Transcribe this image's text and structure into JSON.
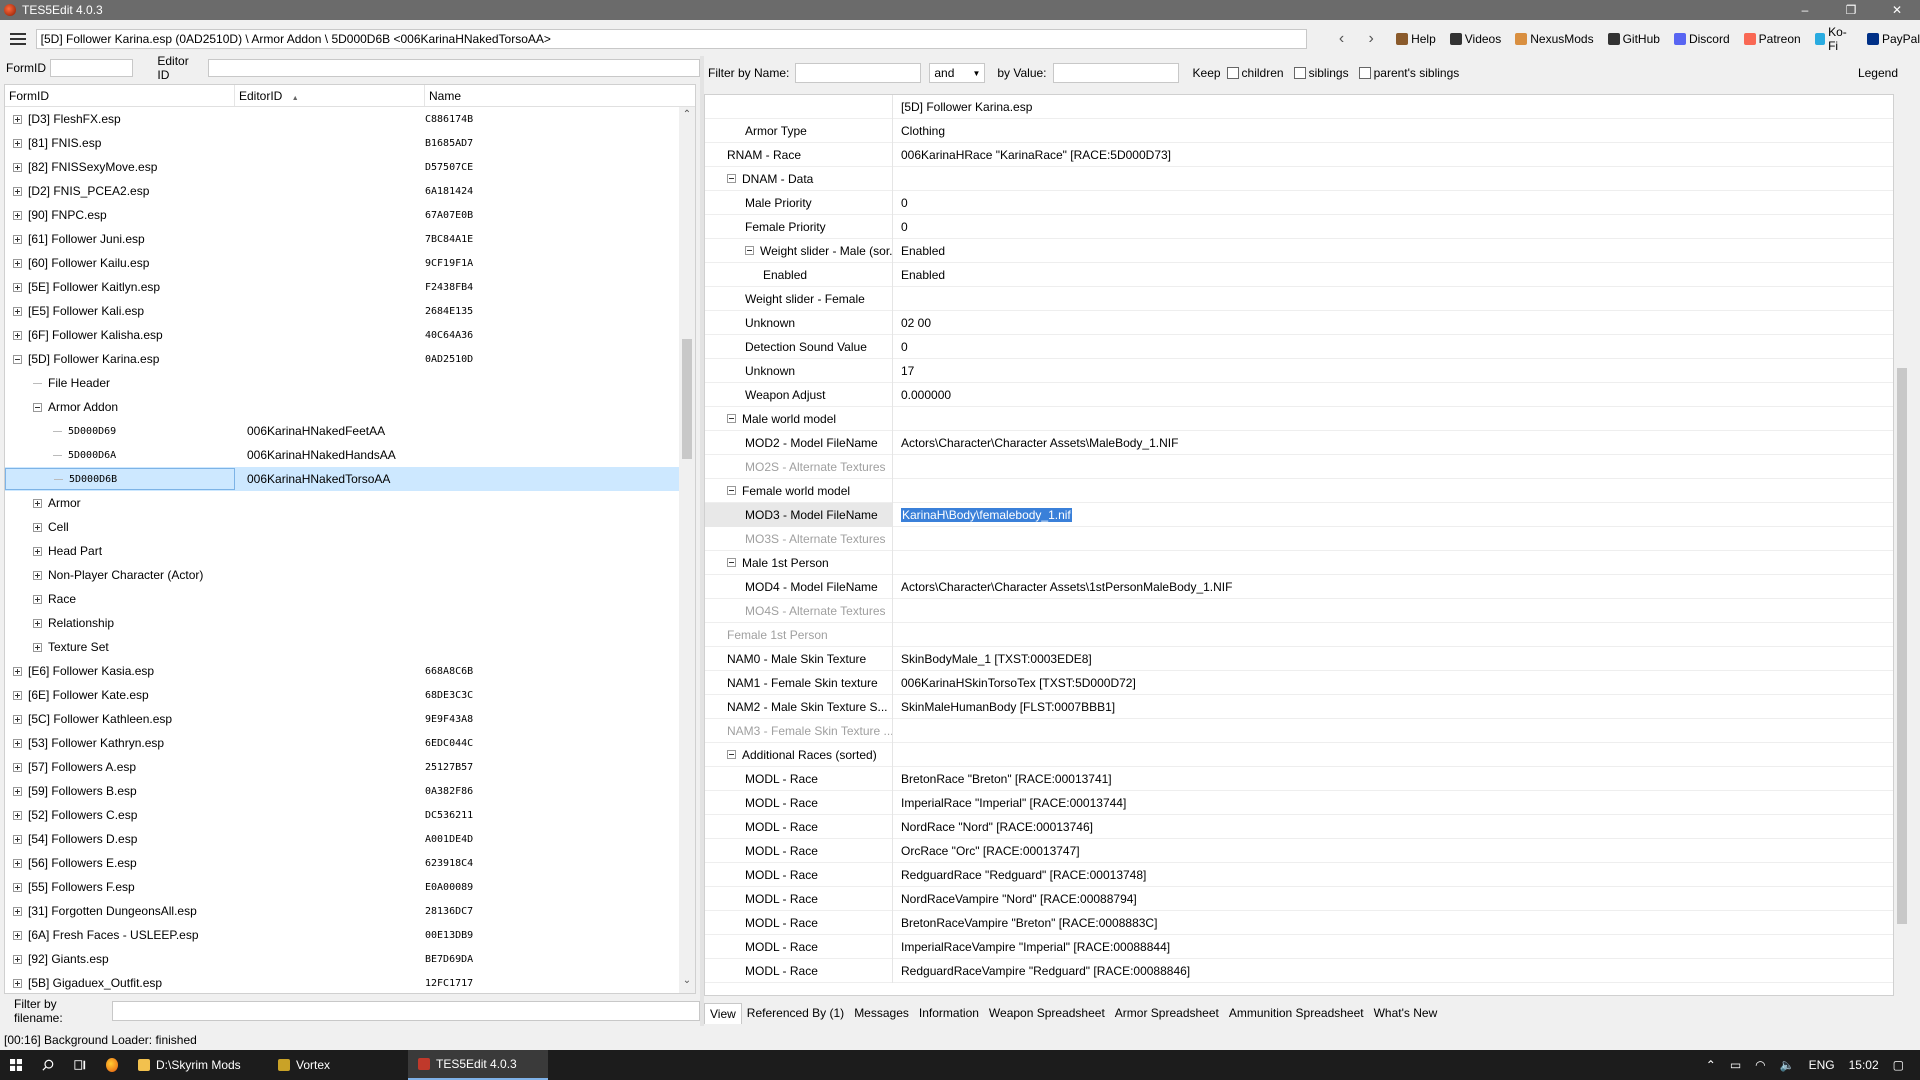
{
  "window": {
    "title": "TES5Edit 4.0.3",
    "minimize": "–",
    "maximize": "❐",
    "close": "✕"
  },
  "pathbar": {
    "path": "[5D] Follower Karina.esp (0AD2510D) \\ Armor Addon \\ 5D000D6B <006KarinaHNakedTorsoAA>",
    "back": "‹",
    "forward": "›",
    "links": [
      {
        "label": "Help",
        "icon": "book-icon",
        "color": "#8a5a2b"
      },
      {
        "label": "Videos",
        "icon": "video-icon",
        "color": "#333333"
      },
      {
        "label": "NexusMods",
        "icon": "nexus-icon",
        "color": "#d98f40"
      },
      {
        "label": "GitHub",
        "icon": "github-icon",
        "color": "#333333"
      },
      {
        "label": "Discord",
        "icon": "discord-icon",
        "color": "#5865f2"
      },
      {
        "label": "Patreon",
        "icon": "patreon-icon",
        "color": "#f96854"
      },
      {
        "label": "Ko-Fi",
        "icon": "kofi-icon",
        "color": "#29abe0"
      },
      {
        "label": "PayPal",
        "icon": "paypal-icon",
        "color": "#003087"
      }
    ]
  },
  "left_filter": {
    "formid_label": "FormID",
    "editorid_label": "Editor ID"
  },
  "tree": {
    "columns": [
      "FormID",
      "EditorID",
      "Name"
    ],
    "sort_indicator": "▲",
    "rows": [
      {
        "indent": 0,
        "exp": "plus",
        "c1": "[D3] FleshFX.esp",
        "c2": "",
        "c3": "C886174B"
      },
      {
        "indent": 0,
        "exp": "plus",
        "c1": "[81] FNIS.esp",
        "c2": "",
        "c3": "B1685AD7"
      },
      {
        "indent": 0,
        "exp": "plus",
        "c1": "[82] FNISSexyMove.esp",
        "c2": "",
        "c3": "D57507CE"
      },
      {
        "indent": 0,
        "exp": "plus",
        "c1": "[D2] FNIS_PCEA2.esp",
        "c2": "",
        "c3": "6A181424"
      },
      {
        "indent": 0,
        "exp": "plus",
        "c1": "[90] FNPC.esp",
        "c2": "",
        "c3": "67A07E0B"
      },
      {
        "indent": 0,
        "exp": "plus",
        "c1": "[61] Follower Juni.esp",
        "c2": "",
        "c3": "7BC84A1E"
      },
      {
        "indent": 0,
        "exp": "plus",
        "c1": "[60] Follower Kailu.esp",
        "c2": "",
        "c3": "9CF19F1A"
      },
      {
        "indent": 0,
        "exp": "plus",
        "c1": "[5E] Follower Kaitlyn.esp",
        "c2": "",
        "c3": "F2438FB4"
      },
      {
        "indent": 0,
        "exp": "plus",
        "c1": "[E5] Follower Kali.esp",
        "c2": "",
        "c3": "2684E135"
      },
      {
        "indent": 0,
        "exp": "plus",
        "c1": "[6F] Follower Kalisha.esp",
        "c2": "",
        "c3": "40C64A36"
      },
      {
        "indent": 0,
        "exp": "minus",
        "c1": "[5D] Follower Karina.esp",
        "c2": "",
        "c3": "0AD2510D"
      },
      {
        "indent": 1,
        "exp": "none",
        "c1": "File Header",
        "c2": "",
        "c3": ""
      },
      {
        "indent": 1,
        "exp": "minus",
        "c1": "Armor Addon",
        "c2": "",
        "c3": ""
      },
      {
        "indent": 2,
        "exp": "none",
        "c1": "5D000D69",
        "c2": "006KarinaHNakedFeetAA",
        "c3": "",
        "mono": true
      },
      {
        "indent": 2,
        "exp": "none",
        "c1": "5D000D6A",
        "c2": "006KarinaHNakedHandsAA",
        "c3": "",
        "mono": true
      },
      {
        "indent": 2,
        "exp": "none",
        "c1": "5D000D6B",
        "c2": "006KarinaHNakedTorsoAA",
        "c3": "",
        "mono": true,
        "selected": true
      },
      {
        "indent": 1,
        "exp": "plus",
        "c1": "Armor",
        "c2": "",
        "c3": ""
      },
      {
        "indent": 1,
        "exp": "plus",
        "c1": "Cell",
        "c2": "",
        "c3": ""
      },
      {
        "indent": 1,
        "exp": "plus",
        "c1": "Head Part",
        "c2": "",
        "c3": ""
      },
      {
        "indent": 1,
        "exp": "plus",
        "c1": "Non-Player Character (Actor)",
        "c2": "",
        "c3": ""
      },
      {
        "indent": 1,
        "exp": "plus",
        "c1": "Race",
        "c2": "",
        "c3": ""
      },
      {
        "indent": 1,
        "exp": "plus",
        "c1": "Relationship",
        "c2": "",
        "c3": ""
      },
      {
        "indent": 1,
        "exp": "plus",
        "c1": "Texture Set",
        "c2": "",
        "c3": ""
      },
      {
        "indent": 0,
        "exp": "plus",
        "c1": "[E6] Follower Kasia.esp",
        "c2": "",
        "c3": "668A8C6B"
      },
      {
        "indent": 0,
        "exp": "plus",
        "c1": "[6E] Follower Kate.esp",
        "c2": "",
        "c3": "68DE3C3C"
      },
      {
        "indent": 0,
        "exp": "plus",
        "c1": "[5C] Follower Kathleen.esp",
        "c2": "",
        "c3": "9E9F43A8"
      },
      {
        "indent": 0,
        "exp": "plus",
        "c1": "[53] Follower Kathryn.esp",
        "c2": "",
        "c3": "6EDC044C"
      },
      {
        "indent": 0,
        "exp": "plus",
        "c1": "[57] Followers A.esp",
        "c2": "",
        "c3": "25127B57"
      },
      {
        "indent": 0,
        "exp": "plus",
        "c1": "[59] Followers B.esp",
        "c2": "",
        "c3": "0A382F86"
      },
      {
        "indent": 0,
        "exp": "plus",
        "c1": "[52] Followers C.esp",
        "c2": "",
        "c3": "DC536211"
      },
      {
        "indent": 0,
        "exp": "plus",
        "c1": "[54] Followers D.esp",
        "c2": "",
        "c3": "A001DE4D"
      },
      {
        "indent": 0,
        "exp": "plus",
        "c1": "[56] Followers E.esp",
        "c2": "",
        "c3": "623918C4"
      },
      {
        "indent": 0,
        "exp": "plus",
        "c1": "[55] Followers F.esp",
        "c2": "",
        "c3": "E0A00089"
      },
      {
        "indent": 0,
        "exp": "plus",
        "c1": "[31] Forgotten DungeonsAll.esp",
        "c2": "",
        "c3": "28136DC7"
      },
      {
        "indent": 0,
        "exp": "plus",
        "c1": "[6A] Fresh Faces - USLEEP.esp",
        "c2": "",
        "c3": "00E13DB9"
      },
      {
        "indent": 0,
        "exp": "plus",
        "c1": "[92] Giants.esp",
        "c2": "",
        "c3": "BE7D69DA"
      },
      {
        "indent": 0,
        "exp": "plus",
        "c1": "[5B] Gigaduex_Outfit.esp",
        "c2": "",
        "c3": "12FC1717"
      }
    ]
  },
  "file_filter": {
    "label": "Filter by filename:"
  },
  "status": {
    "text": "[00:16] Background Loader: finished"
  },
  "right_filter": {
    "by_name": "Filter by Name:",
    "op": "and",
    "by_value": "by Value:",
    "keep": "Keep",
    "children": "children",
    "siblings": "siblings",
    "parents_siblings": "parent's siblings",
    "legend": "Legend"
  },
  "grid": {
    "header_value": "[5D] Follower Karina.esp",
    "rows": [
      {
        "indent": 2,
        "exp": "none",
        "label": "Armor Type",
        "value": "Clothing"
      },
      {
        "indent": 1,
        "exp": "none",
        "label": "RNAM - Race",
        "value": "006KarinaHRace \"KarinaRace\" [RACE:5D000D73]"
      },
      {
        "indent": 1,
        "exp": "minus",
        "label": "DNAM - Data",
        "value": ""
      },
      {
        "indent": 2,
        "exp": "none",
        "label": "Male Priority",
        "value": "0"
      },
      {
        "indent": 2,
        "exp": "none",
        "label": "Female Priority",
        "value": "0"
      },
      {
        "indent": 2,
        "exp": "minus",
        "label": "Weight slider - Male (sor...",
        "value": "Enabled"
      },
      {
        "indent": 3,
        "exp": "none",
        "label": "Enabled",
        "value": "Enabled"
      },
      {
        "indent": 2,
        "exp": "none",
        "label": "Weight slider - Female",
        "value": ""
      },
      {
        "indent": 2,
        "exp": "none",
        "label": "Unknown",
        "value": "02 00"
      },
      {
        "indent": 2,
        "exp": "none",
        "label": "Detection Sound Value",
        "value": "0"
      },
      {
        "indent": 2,
        "exp": "none",
        "label": "Unknown",
        "value": "17"
      },
      {
        "indent": 2,
        "exp": "none",
        "label": "Weapon Adjust",
        "value": "0.000000"
      },
      {
        "indent": 1,
        "exp": "minus",
        "label": "Male world model",
        "value": ""
      },
      {
        "indent": 2,
        "exp": "none",
        "label": "MOD2 - Model FileName",
        "value": "Actors\\Character\\Character Assets\\MaleBody_1.NIF"
      },
      {
        "indent": 2,
        "exp": "none",
        "label": "MO2S - Alternate Textures",
        "value": "",
        "grey": true
      },
      {
        "indent": 1,
        "exp": "minus",
        "label": "Female world model",
        "value": ""
      },
      {
        "indent": 2,
        "exp": "none",
        "label": "MOD3 - Model FileName",
        "value": "KarinaH\\Body\\femalebody_1.nif",
        "selected": true
      },
      {
        "indent": 2,
        "exp": "none",
        "label": "MO3S - Alternate Textures",
        "value": "",
        "grey": true
      },
      {
        "indent": 1,
        "exp": "minus",
        "label": "Male 1st Person",
        "value": ""
      },
      {
        "indent": 2,
        "exp": "none",
        "label": "MOD4 - Model FileName",
        "value": "Actors\\Character\\Character Assets\\1stPersonMaleBody_1.NIF"
      },
      {
        "indent": 2,
        "exp": "none",
        "label": "MO4S - Alternate Textures",
        "value": "",
        "grey": true
      },
      {
        "indent": 1,
        "exp": "none",
        "label": "Female 1st Person",
        "value": "",
        "grey": true
      },
      {
        "indent": 1,
        "exp": "none",
        "label": "NAM0 - Male Skin Texture",
        "value": "SkinBodyMale_1 [TXST:0003EDE8]"
      },
      {
        "indent": 1,
        "exp": "none",
        "label": "NAM1 - Female Skin texture",
        "value": "006KarinaHSkinTorsoTex [TXST:5D000D72]"
      },
      {
        "indent": 1,
        "exp": "none",
        "label": "NAM2 - Male Skin Texture S...",
        "value": "SkinMaleHumanBody [FLST:0007BBB1]"
      },
      {
        "indent": 1,
        "exp": "none",
        "label": "NAM3 - Female Skin Texture ...",
        "value": "",
        "grey": true
      },
      {
        "indent": 1,
        "exp": "minus",
        "label": "Additional Races (sorted)",
        "value": ""
      },
      {
        "indent": 2,
        "exp": "none",
        "label": "MODL - Race",
        "value": "BretonRace \"Breton\" [RACE:00013741]"
      },
      {
        "indent": 2,
        "exp": "none",
        "label": "MODL - Race",
        "value": "ImperialRace \"Imperial\" [RACE:00013744]"
      },
      {
        "indent": 2,
        "exp": "none",
        "label": "MODL - Race",
        "value": "NordRace \"Nord\" [RACE:00013746]"
      },
      {
        "indent": 2,
        "exp": "none",
        "label": "MODL - Race",
        "value": "OrcRace \"Orc\" [RACE:00013747]"
      },
      {
        "indent": 2,
        "exp": "none",
        "label": "MODL - Race",
        "value": "RedguardRace \"Redguard\" [RACE:00013748]"
      },
      {
        "indent": 2,
        "exp": "none",
        "label": "MODL - Race",
        "value": "NordRaceVampire \"Nord\" [RACE:00088794]"
      },
      {
        "indent": 2,
        "exp": "none",
        "label": "MODL - Race",
        "value": "BretonRaceVampire \"Breton\" [RACE:0008883C]"
      },
      {
        "indent": 2,
        "exp": "none",
        "label": "MODL - Race",
        "value": "ImperialRaceVampire \"Imperial\" [RACE:00088844]"
      },
      {
        "indent": 2,
        "exp": "none",
        "label": "MODL - Race",
        "value": "RedguardRaceVampire \"Redguard\" [RACE:00088846]"
      }
    ]
  },
  "tabs": [
    "View",
    "Referenced By (1)",
    "Messages",
    "Information",
    "Weapon Spreadsheet",
    "Armor Spreadsheet",
    "Ammunition Spreadsheet",
    "What's New"
  ],
  "taskbar": {
    "apps": [
      {
        "label": "D:\\Skyrim Mods",
        "icon": "folder-icon"
      },
      {
        "label": "Vortex",
        "icon": "vortex-icon"
      },
      {
        "label": "TES5Edit 4.0.3",
        "icon": "tes5edit-icon",
        "active": true
      }
    ],
    "lang": "ENG",
    "time": "15:02"
  }
}
